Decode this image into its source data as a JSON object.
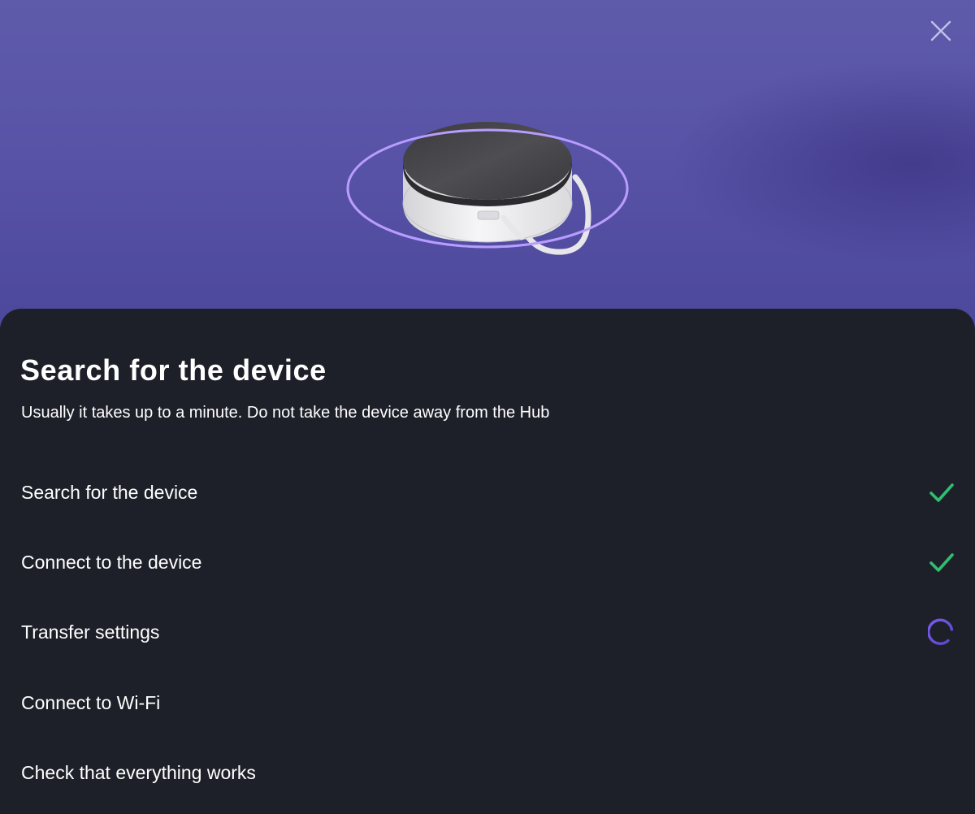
{
  "dialog": {
    "title": "Search for the device",
    "subtitle": "Usually it takes up to a minute. Do not take the device away from the Hub",
    "close_icon": "close-icon"
  },
  "hero": {
    "illustration": "hub-device-illustration",
    "background_color": "#5a56a8",
    "ring_color": "#b89cff"
  },
  "steps": [
    {
      "label": "Search for the device",
      "status": "done",
      "icon": "checkmark-icon"
    },
    {
      "label": "Connect to the device",
      "status": "done",
      "icon": "checkmark-icon"
    },
    {
      "label": "Transfer settings",
      "status": "in-progress",
      "icon": "loading-spinner-icon"
    },
    {
      "label": "Connect to Wi-Fi",
      "status": "pending",
      "icon": ""
    },
    {
      "label": "Check that everything works",
      "status": "pending",
      "icon": ""
    }
  ],
  "colors": {
    "sheet_background": "#1e2029",
    "success": "#2fbf71",
    "accent": "#7a5cf0",
    "text": "#ffffff"
  }
}
